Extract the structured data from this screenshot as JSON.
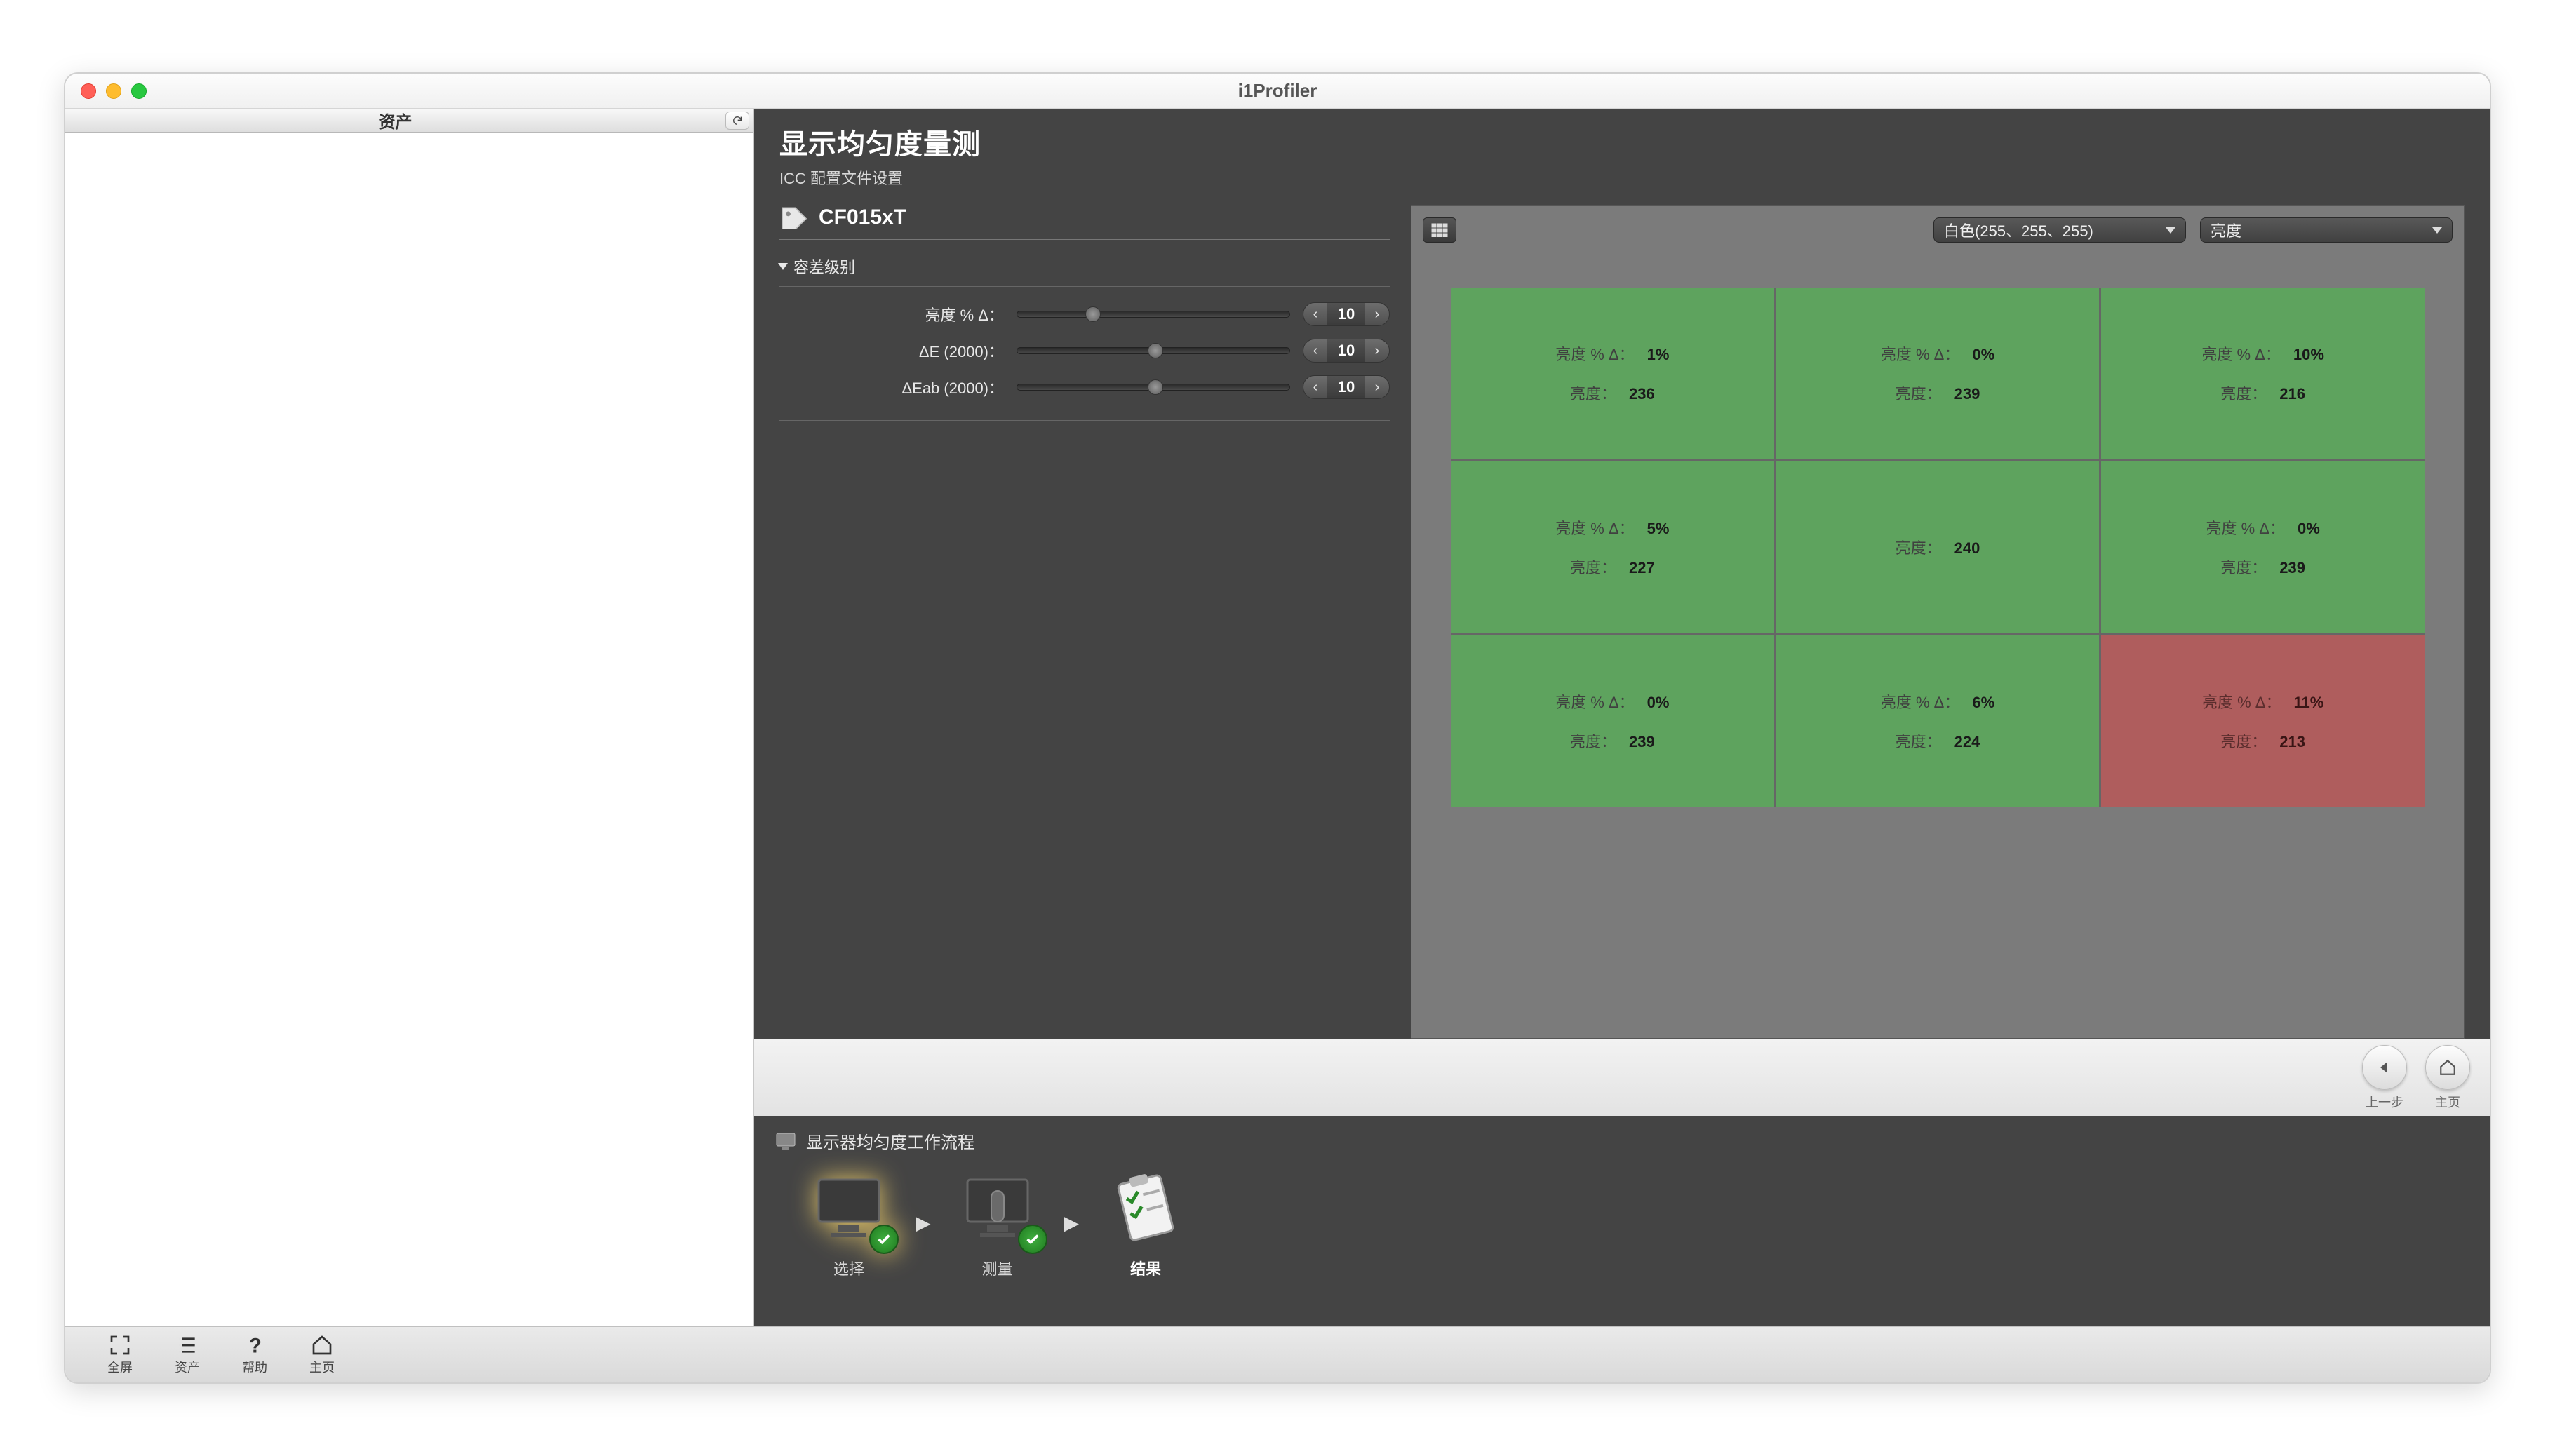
{
  "app": {
    "title": "i1Profiler"
  },
  "assets": {
    "header": "资产"
  },
  "page": {
    "title": "显示均匀度量测",
    "subtitle": "ICC 配置文件设置"
  },
  "device": {
    "name": "CF015xT"
  },
  "tolerance": {
    "section_label": "容差级别",
    "rows": [
      {
        "label": "亮度 % Δ：",
        "value": "10",
        "pos": 25
      },
      {
        "label": "ΔE (2000)：",
        "value": "10",
        "pos": 48
      },
      {
        "label": "ΔEab (2000)：",
        "value": "10",
        "pos": 48
      }
    ]
  },
  "viewport": {
    "dropdown_color": "白色(255、255、255)",
    "dropdown_metric": "亮度",
    "delta_label": "亮度 % Δ：",
    "value_label": "亮度：",
    "cells": [
      {
        "delta": "1%",
        "value": "236",
        "status": "pass"
      },
      {
        "delta": "0%",
        "value": "239",
        "status": "pass"
      },
      {
        "delta": "10%",
        "value": "216",
        "status": "pass"
      },
      {
        "delta": "5%",
        "value": "227",
        "status": "pass"
      },
      {
        "delta": "",
        "value": "240",
        "status": "center"
      },
      {
        "delta": "0%",
        "value": "239",
        "status": "pass"
      },
      {
        "delta": "0%",
        "value": "239",
        "status": "pass"
      },
      {
        "delta": "6%",
        "value": "224",
        "status": "pass"
      },
      {
        "delta": "11%",
        "value": "213",
        "status": "fail"
      }
    ]
  },
  "nav": {
    "prev": "上一步",
    "home": "主页"
  },
  "workflow": {
    "title": "显示器均匀度工作流程",
    "steps": [
      {
        "label": "选择",
        "checked": true
      },
      {
        "label": "测量",
        "checked": true
      },
      {
        "label": "结果",
        "checked": false,
        "active": true
      }
    ]
  },
  "bottombar": {
    "fullscreen": "全屏",
    "assets": "资产",
    "help": "帮助",
    "home": "主页"
  }
}
